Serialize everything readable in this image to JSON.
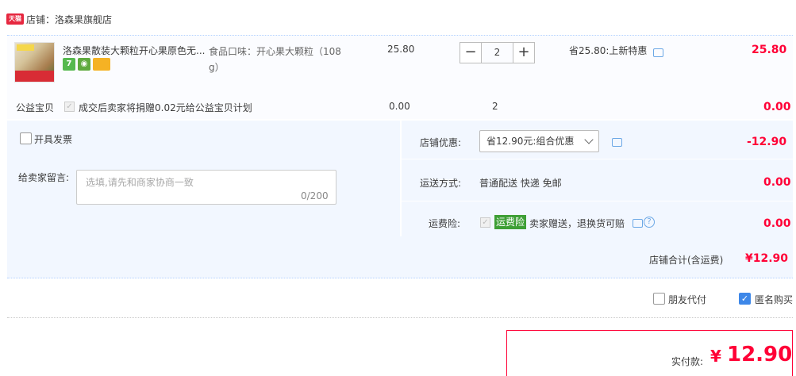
{
  "header": {
    "badge": "天猫",
    "store_label": "店铺：洛森果旗舰店"
  },
  "item": {
    "title": "洛森果散装大颗粒开心果原色无...",
    "sku_line1": "食品口味：开心果大颗粒（108",
    "sku_line2": "g）",
    "unit_price": "25.80",
    "qty": "2",
    "minus": "−",
    "plus": "+",
    "promo": "省25.80:上新特惠",
    "total": "25.80",
    "service_icons": [
      "seven-day-return-icon",
      "guarantee-icon",
      "credit-card-icon"
    ],
    "service_glyphs": [
      "7",
      "◉",
      ""
    ]
  },
  "charity": {
    "label": "公益宝贝",
    "text": "成交后卖家将捐赠0.02元给公益宝贝计划",
    "price": "0.00",
    "qty": "2",
    "total": "0.00"
  },
  "options": {
    "invoice_label": "开具发票",
    "message_label": "给卖家留言:",
    "message_placeholder": "选填,请先和商家协商一致",
    "message_count": "0/200",
    "discount_label": "店铺优惠:",
    "discount_value": "省12.90元:组合优惠",
    "discount_amount": "-12.90",
    "shipping_label": "运送方式:",
    "shipping_value": "普通配送 快递 免邮",
    "shipping_amount": "0.00",
    "insurance_label": "运费险:",
    "insurance_badge": "运费险",
    "insurance_text": "卖家赠送，退换货可赔",
    "insurance_amount": "0.00",
    "help_glyph": "?"
  },
  "summary": {
    "label": "店铺合计(含运费)",
    "amount": "¥12.90"
  },
  "bottom": {
    "friend_pay_label": "朋友代付",
    "anonymous_label": "匿名购买",
    "anonymous_check": "✓",
    "pay_label": "实付款:",
    "pay_currency": "¥",
    "pay_amount": "12.90"
  },
  "colors": {
    "accent_red": "#ff0036",
    "panel_blue": "#f2f7ff",
    "link_blue": "#3d87e8",
    "insurance_green": "#3e9f36"
  }
}
